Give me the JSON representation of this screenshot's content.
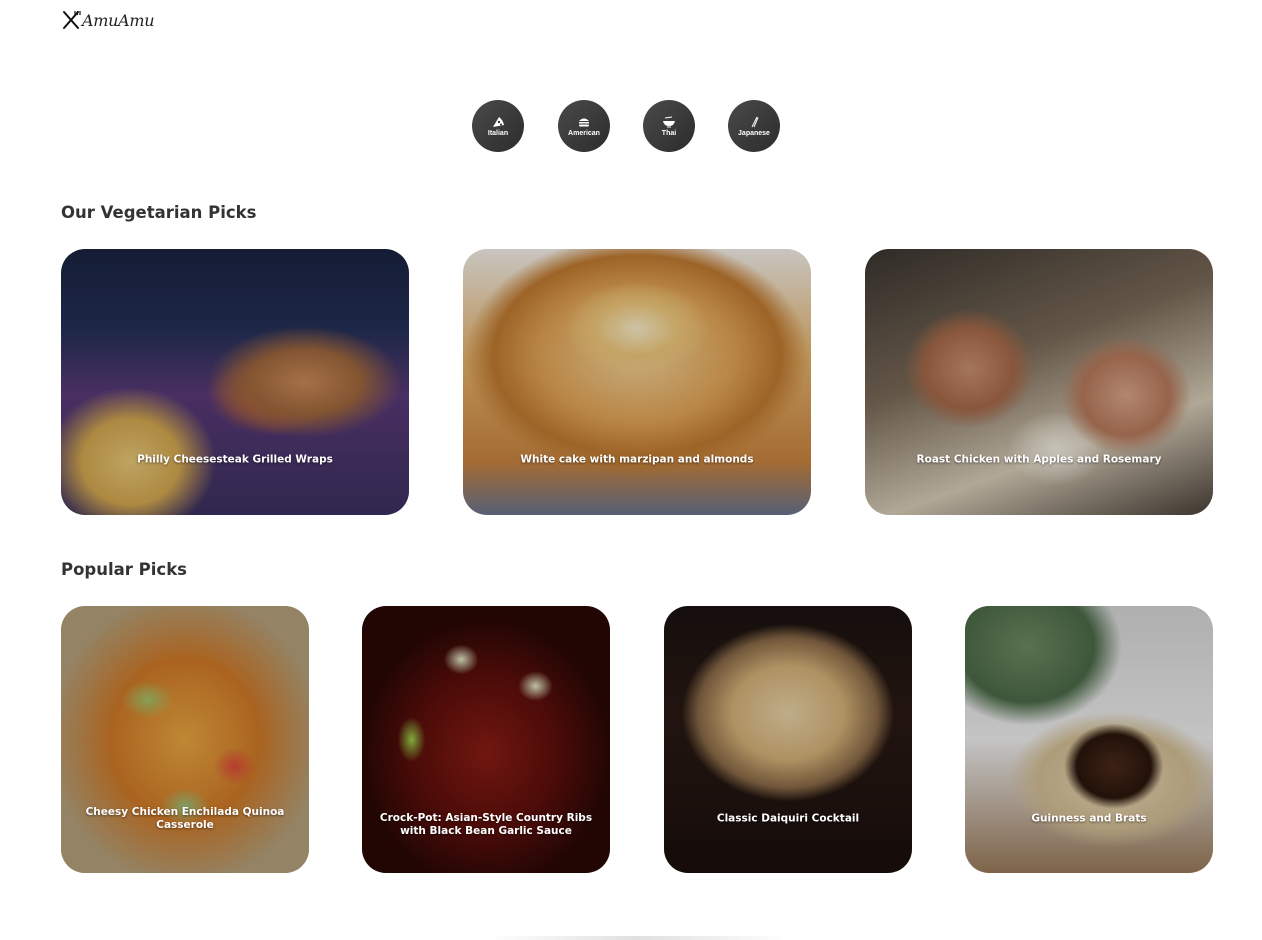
{
  "brand": {
    "logo_icon": "fork-knife-icon",
    "name": "AmuAmu"
  },
  "categories": [
    {
      "label": "Italian",
      "icon": "pizza-icon"
    },
    {
      "label": "American",
      "icon": "burger-icon"
    },
    {
      "label": "Thai",
      "icon": "bowl-icon"
    },
    {
      "label": "Japanese",
      "icon": "chopsticks-icon"
    }
  ],
  "vegetarian": {
    "title": "Our Vegetarian Picks",
    "items": [
      {
        "title": "Philly Cheesesteak Grilled Wraps"
      },
      {
        "title": "White cake with marzipan and almonds"
      },
      {
        "title": "Roast Chicken with Apples and Rosemary"
      }
    ]
  },
  "popular": {
    "title": "Popular Picks",
    "items": [
      {
        "title": "Cheesy Chicken Enchilada Quinoa Casserole"
      },
      {
        "title": "Crock-Pot: Asian-Style Country Ribs with Black Bean Garlic Sauce"
      },
      {
        "title": "Classic Daiquiri Cocktail"
      },
      {
        "title": "Guinness and Brats"
      }
    ]
  }
}
